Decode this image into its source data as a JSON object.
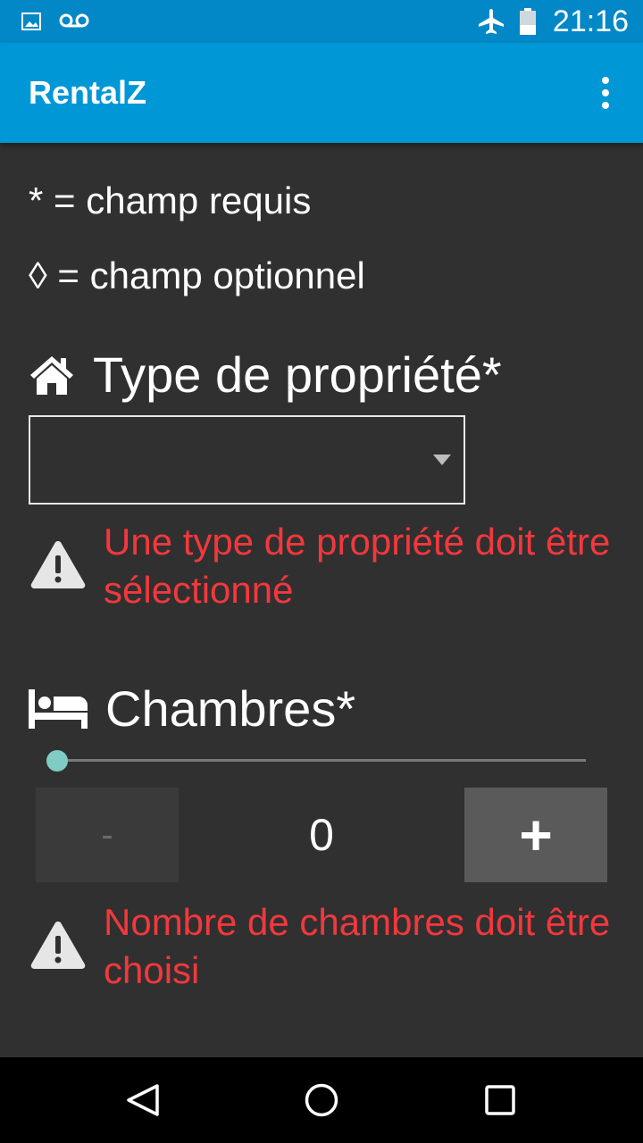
{
  "status_bar": {
    "time": "21:16",
    "left_icons": [
      "image-icon",
      "voicemail-icon"
    ],
    "right_icons": [
      "airplane-mode-icon",
      "battery-icon"
    ]
  },
  "app_bar": {
    "title": "RentalZ",
    "menu_icon": "overflow-menu-icon",
    "color": "#0097d6"
  },
  "legend": {
    "required": "* = champ requis",
    "optional": "◊ = champ optionnel"
  },
  "property_type": {
    "icon": "house-icon",
    "label": "Type de propriété*",
    "selected_value": "",
    "error": "Une type de propriété doit être sélectionné"
  },
  "bedrooms": {
    "icon": "bed-icon",
    "label": "Chambres*",
    "slider_value": 0,
    "minus_label": "-",
    "plus_label": "+",
    "value": "0",
    "error": "Nombre de chambres doit être choisi"
  },
  "colors": {
    "background": "#303030",
    "error": "#f2383d",
    "accent": "#80cbc4"
  },
  "nav_bar": {
    "icons": [
      "back-icon",
      "home-icon",
      "recent-apps-icon"
    ]
  }
}
